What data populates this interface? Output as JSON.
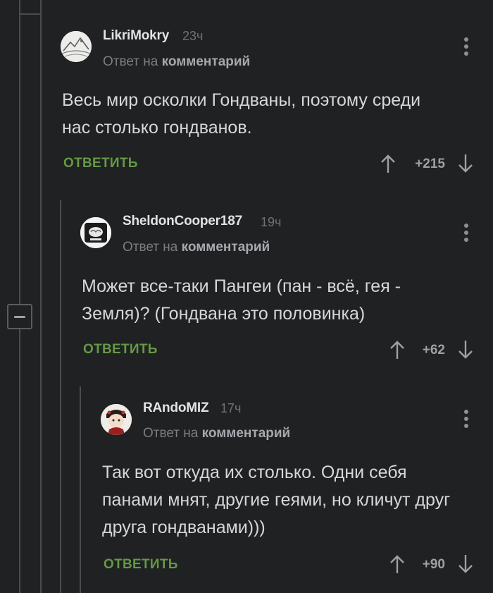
{
  "comments": [
    {
      "author": "LikriMokry",
      "time": "23ч",
      "reply_prefix": "Ответ на",
      "reply_target": "комментарий",
      "text": "Весь мир осколки Гондваны, поэтому среди нас столько гондванов.",
      "reply_label": "ОТВЕТИТЬ",
      "rating": "+215",
      "avatar_icon": "landscape-sketch-avatar"
    },
    {
      "author": "SheldonCooper187",
      "time": "19ч",
      "reply_prefix": "Ответ на",
      "reply_target": "комментарий",
      "text": "Может все-таки Пангеи (пан - всё, гея - Земля)? (Гондвана это половинка)",
      "reply_label": "ОТВЕТИТЬ",
      "rating": "+62",
      "avatar_icon": "brain-avatar"
    },
    {
      "author": "RAndoMIZ",
      "time": "17ч",
      "reply_prefix": "Ответ на",
      "reply_target": "комментарий",
      "text": "Так вот откуда их столько. Одни себя панами мнят, другие геями, но кличут друг друга гондванами)))",
      "reply_label": "ОТВЕТИТЬ",
      "rating": "+90",
      "avatar_icon": "doll-avatar"
    }
  ],
  "colors": {
    "background": "#1f2123",
    "reply_green": "#659944",
    "text": "#d5d7d9",
    "muted": "#7b7e82",
    "thread_line": "#4a4d50"
  }
}
